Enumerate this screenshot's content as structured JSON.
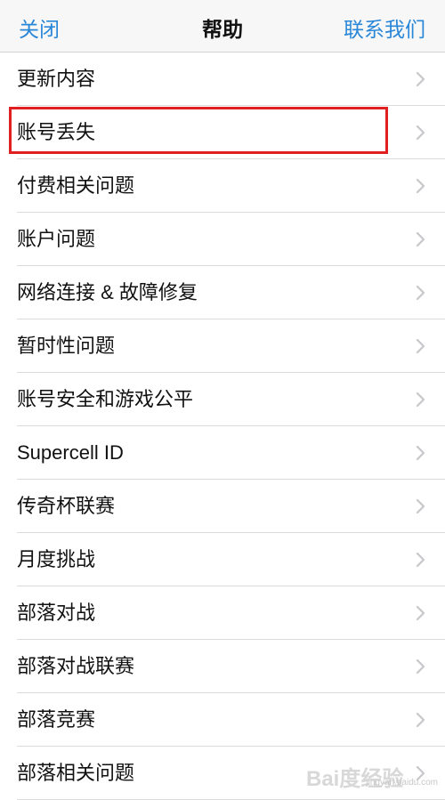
{
  "navbar": {
    "close_label": "关闭",
    "title": "帮助",
    "contact_label": "联系我们"
  },
  "items": [
    {
      "label": "更新内容"
    },
    {
      "label": "账号丢失"
    },
    {
      "label": "付费相关问题"
    },
    {
      "label": "账户问题"
    },
    {
      "label": "网络连接 & 故障修复"
    },
    {
      "label": "暂时性问题"
    },
    {
      "label": "账号安全和游戏公平"
    },
    {
      "label": "Supercell ID"
    },
    {
      "label": "传奇杯联赛"
    },
    {
      "label": "月度挑战"
    },
    {
      "label": "部落对战"
    },
    {
      "label": "部落对战联赛"
    },
    {
      "label": "部落竞赛"
    },
    {
      "label": "部落相关问题"
    }
  ],
  "highlighted_item": "账号丢失",
  "watermark": {
    "text": "Bai度经验",
    "url": "jingyan.baidu.com"
  },
  "colors": {
    "accent": "#2a87d8",
    "highlight": "#e02020",
    "chevron": "#c7c7cc"
  },
  "icons": {
    "chevron": "chevron-right-icon"
  }
}
